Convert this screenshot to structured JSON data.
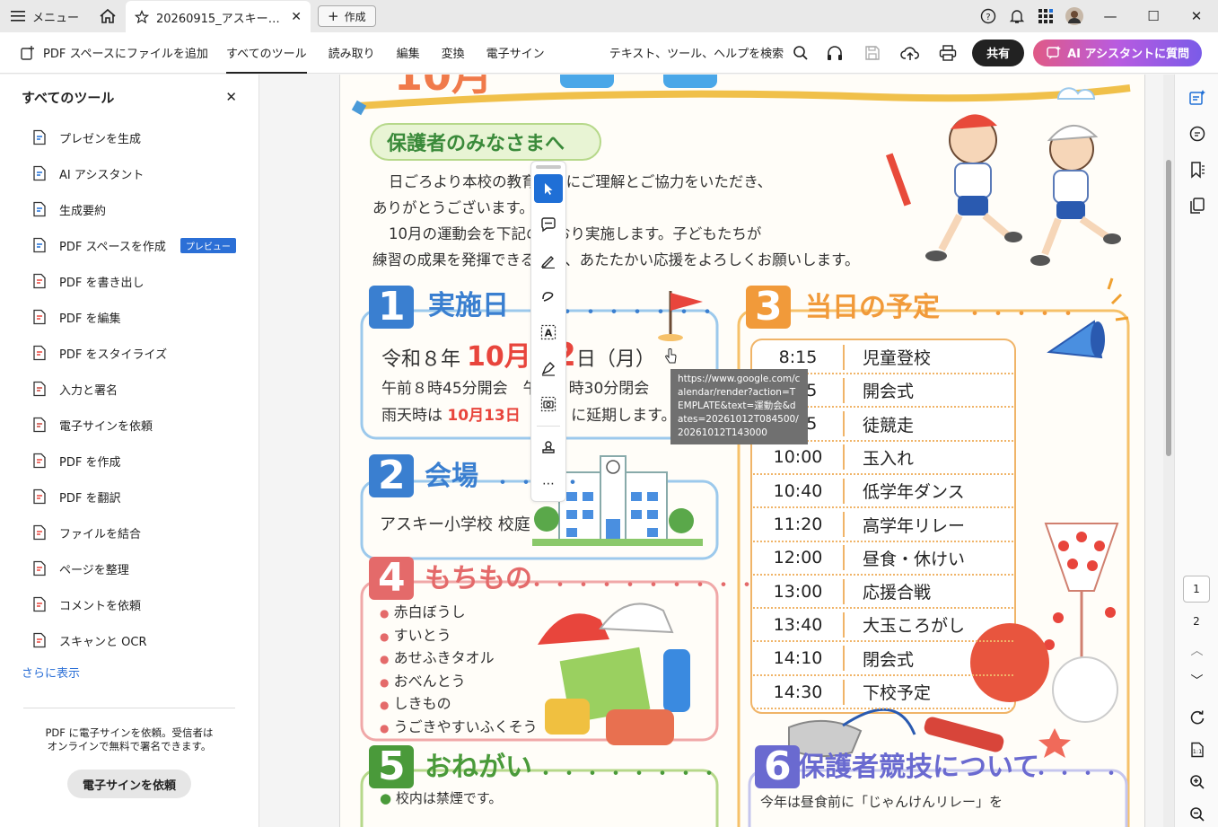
{
  "titlebar": {
    "menu_label": "メニュー",
    "tab_title": "20260915_アスキー小...",
    "create_label": "作成"
  },
  "toolbar": {
    "add_to_space": "PDF スペースにファイルを追加",
    "tabs": [
      "すべてのツール",
      "読み取り",
      "編集",
      "変換",
      "電子サイン"
    ],
    "search_text": "テキスト、ツール、ヘルプを検索",
    "share_label": "共有",
    "ai_label": "AI アシスタントに質問"
  },
  "left_panel": {
    "title": "すべてのツール",
    "items": [
      {
        "label": "プレゼンを生成",
        "icon": "presentation-icon"
      },
      {
        "label": "AI アシスタント",
        "icon": "ai-assistant-icon"
      },
      {
        "label": "生成要約",
        "icon": "summary-icon"
      },
      {
        "label": "PDF スペースを作成",
        "icon": "pdf-space-icon",
        "badge": "プレビュー"
      },
      {
        "label": "PDF を書き出し",
        "icon": "export-pdf-icon"
      },
      {
        "label": "PDF を編集",
        "icon": "edit-pdf-icon"
      },
      {
        "label": "PDF をスタイライズ",
        "icon": "stylize-icon"
      },
      {
        "label": "入力と署名",
        "icon": "fill-sign-icon"
      },
      {
        "label": "電子サインを依頼",
        "icon": "request-esign-icon"
      },
      {
        "label": "PDF を作成",
        "icon": "create-pdf-icon"
      },
      {
        "label": "PDF を翻訳",
        "icon": "translate-icon"
      },
      {
        "label": "ファイルを結合",
        "icon": "combine-icon"
      },
      {
        "label": "ページを整理",
        "icon": "organize-icon"
      },
      {
        "label": "コメントを依頼",
        "icon": "request-comment-icon"
      },
      {
        "label": "スキャンと OCR",
        "icon": "scan-ocr-icon"
      }
    ],
    "more_label": "さらに表示",
    "promo_line1": "PDF に電子サインを依頼。受信者は",
    "promo_line2": "オンラインで無料で署名できます。",
    "promo_button": "電子サインを依頼"
  },
  "document": {
    "greeting_heading": "保護者のみなさまへ",
    "greeting_lines": [
      "日ごろより本校の教育活動にご理解とご協力をいただき、",
      "ありがとうございます。",
      "10月の運動会を下記のとおり実施します。子どもたちが",
      "練習の成果を発揮できるよう、あたたかい応援をよろしくお願いします。"
    ],
    "sec1": {
      "num": "1",
      "title": "実施日",
      "date_prefix": "令和８年",
      "date_month": "10月",
      "date_day": "12",
      "date_suffix": "日（月）",
      "time_line": "午前８時45分開会　午後２時30分閉会",
      "rain_prefix": "雨天時は",
      "rain_date": "10月13日（火）",
      "rain_suffix": "に延期します。"
    },
    "sec2": {
      "num": "2",
      "title": "会場",
      "venue": "アスキー小学校 校庭"
    },
    "sec3": {
      "num": "3",
      "title": "当日の予定",
      "schedule": [
        {
          "time": "8:15",
          "event": "児童登校"
        },
        {
          "time": "8:45",
          "event": "開会式"
        },
        {
          "time": "9:15",
          "event": "徒競走"
        },
        {
          "time": "10:00",
          "event": "玉入れ"
        },
        {
          "time": "10:40",
          "event": "低学年ダンス"
        },
        {
          "time": "11:20",
          "event": "高学年リレー"
        },
        {
          "time": "12:00",
          "event": "昼食・休けい"
        },
        {
          "time": "13:00",
          "event": "応援合戦"
        },
        {
          "time": "13:40",
          "event": "大玉ころがし"
        },
        {
          "time": "14:10",
          "event": "閉会式"
        },
        {
          "time": "14:30",
          "event": "下校予定"
        }
      ]
    },
    "sec4": {
      "num": "4",
      "title": "もちもの",
      "items": [
        "赤白ぼうし",
        "すいとう",
        "あせふきタオル",
        "おべんとう",
        "しきもの",
        "うごきやすいふくそう"
      ]
    },
    "sec5": {
      "num": "5",
      "title": "おねがい",
      "first_line": "校内は禁煙です。"
    },
    "sec6": {
      "num": "6",
      "title": "保護者競技について",
      "first_line": "今年は昼食前に「じゃんけんリレー」を"
    }
  },
  "tooltip": {
    "text": "https://www.google.com/calendar/render?action=TEMPLATE&text=運動会&dates=20261012T084500/20261012T143000"
  },
  "page_nav": {
    "pages": [
      "1",
      "2"
    ],
    "current": "1"
  },
  "colors": {
    "accent_blue": "#1f6fd6",
    "share_bg": "#222222",
    "sec1_blue": "#3a7fd0",
    "sec2_blue": "#3a7fd0",
    "sec3_orange": "#f19a3a",
    "sec4_red": "#e46a6a",
    "sec5_green": "#4a9a3a",
    "sec6_purple": "#6a6ad0",
    "date_red": "#e8453c"
  }
}
